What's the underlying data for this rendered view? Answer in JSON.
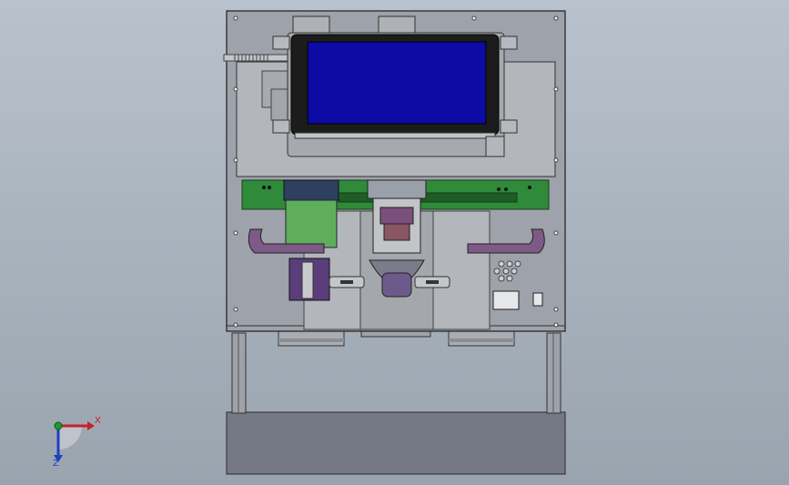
{
  "viewport": {
    "name": "cad-3d-viewport",
    "background_top": "#b9c2cc",
    "background_bottom": "#9aa4af"
  },
  "model": {
    "frame_color": "#9ea2aa",
    "panel_color": "#b3b6bb",
    "screen_color": "#0d0aa5",
    "pcb_color": "#2f8a3a",
    "motor_color": "#5fae5b",
    "bracket_color": "#7e5a86",
    "base_color": "#757984"
  },
  "triad": {
    "x_label": "X",
    "z_label": "Z",
    "x_color": "#c8202a",
    "y_color": "#1e9a2e",
    "z_color": "#1f3fbf"
  }
}
